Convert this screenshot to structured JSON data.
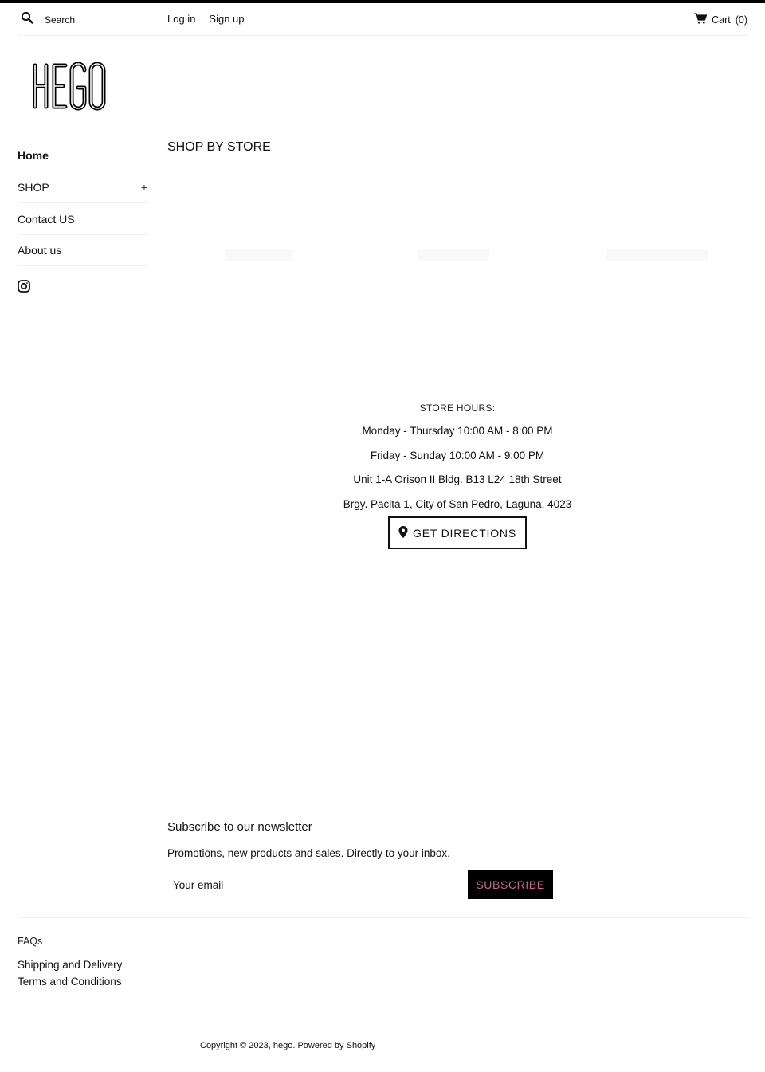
{
  "header": {
    "search_placeholder": "Search",
    "login_label": "Log in",
    "signup_label": "Sign up",
    "cart_label": "Cart",
    "cart_count": "(0)"
  },
  "brand": {
    "logo_text": "HEGO"
  },
  "sidebar": {
    "items": [
      {
        "label": "Home",
        "active": true
      },
      {
        "label": "SHOP",
        "expand": "+"
      },
      {
        "label": "Contact US"
      },
      {
        "label": "About us"
      }
    ],
    "social": [
      "instagram-icon"
    ]
  },
  "main": {
    "title": "SHOP BY STORE",
    "store": {
      "hours_label": "STORE HOURS:",
      "lines": [
        "Monday - Thursday 10:00 AM - 8:00 PM",
        "Friday - Sunday 10:00 AM - 9:00 PM",
        "Unit 1-A Orison II Bldg. B13 L24 18th Street",
        "Brgy. Pacita 1, City of San Pedro, Laguna, 4023"
      ],
      "directions_label": "GET DIRECTIONS"
    }
  },
  "newsletter": {
    "title": "Subscribe to our newsletter",
    "subtitle": "Promotions, new products and sales. Directly to your inbox.",
    "email_placeholder": "Your email",
    "subscribe_label": "SUBSCRIBE",
    "subscribe_text_color": "#c46a8f"
  },
  "footer": {
    "heading": "FAQs",
    "links": [
      "Shipping and Delivery",
      "Terms and Conditions"
    ],
    "copyright": "Copyright © 2023, hego. Powered by Shopify"
  }
}
